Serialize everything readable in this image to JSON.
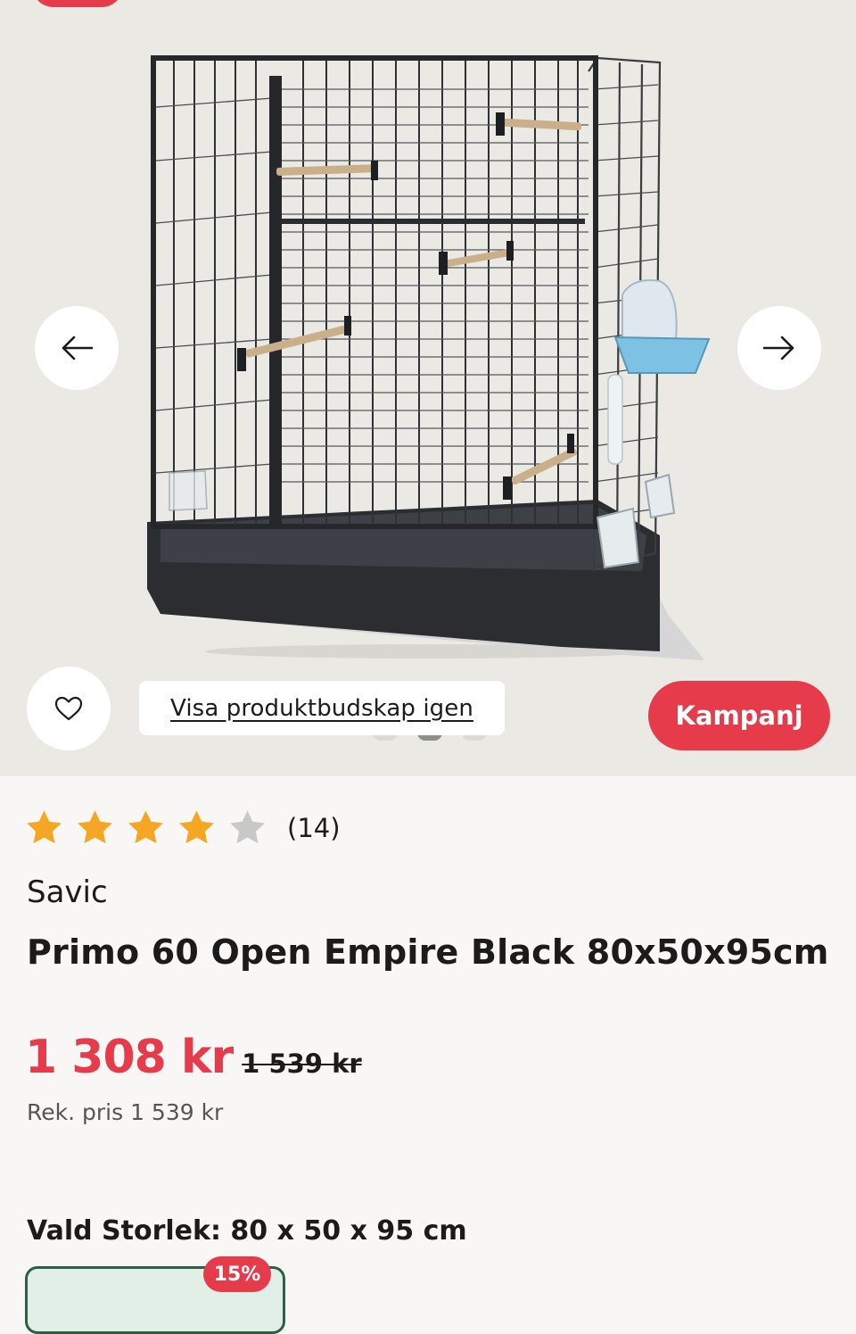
{
  "product": {
    "rating": 4,
    "rating_max": 5,
    "review_count": "(14)",
    "brand": "Savic",
    "title": "Primo 60 Open Empire Black 80x50x95cm",
    "price": "1 308 kr",
    "old_price": "1 539 kr",
    "rek_price": "Rek. pris 1 539 kr"
  },
  "gallery": {
    "show_message_label": "Visa produktbudskap igen",
    "campaign_label": "Kampanj",
    "image_count": 3,
    "active_image": 2
  },
  "size": {
    "label": "Vald Storlek: 80 x 50 x 95 cm",
    "discount": "15%"
  },
  "icons": {
    "prev": "arrow-left-icon",
    "next": "arrow-right-icon",
    "favorite": "heart-icon",
    "star": "star-icon"
  },
  "colors": {
    "accent": "#e63b4b",
    "star_filled": "#f5a623",
    "star_empty": "#c8c8c8",
    "chip_border": "#2f5e46"
  }
}
